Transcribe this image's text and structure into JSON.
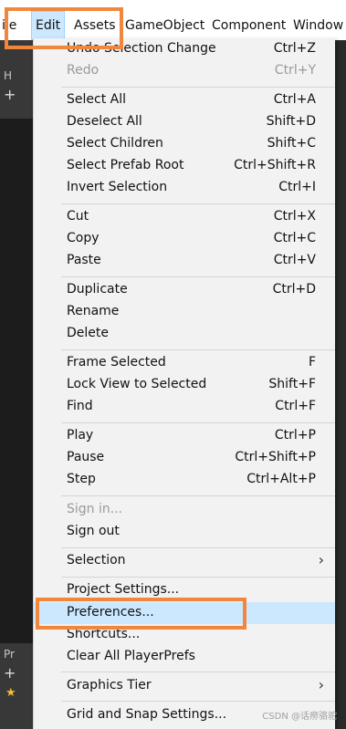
{
  "menubar": {
    "items": [
      {
        "label": "ile"
      },
      {
        "label": "Edit"
      },
      {
        "label": "Assets"
      },
      {
        "label": "GameObject"
      },
      {
        "label": "Component"
      },
      {
        "label": "Window"
      }
    ]
  },
  "background": {
    "hierarchy_label": "H",
    "plus": "+",
    "project_label": "Pr",
    "plus2": "+"
  },
  "menu": {
    "items": [
      {
        "label": "Undo Selection Change",
        "shortcut": "Ctrl+Z"
      },
      {
        "label": "Redo",
        "shortcut": "Ctrl+Y"
      },
      {
        "label": "Select All",
        "shortcut": "Ctrl+A"
      },
      {
        "label": "Deselect All",
        "shortcut": "Shift+D"
      },
      {
        "label": "Select Children",
        "shortcut": "Shift+C"
      },
      {
        "label": "Select Prefab Root",
        "shortcut": "Ctrl+Shift+R"
      },
      {
        "label": "Invert Selection",
        "shortcut": "Ctrl+I"
      },
      {
        "label": "Cut",
        "shortcut": "Ctrl+X"
      },
      {
        "label": "Copy",
        "shortcut": "Ctrl+C"
      },
      {
        "label": "Paste",
        "shortcut": "Ctrl+V"
      },
      {
        "label": "Duplicate",
        "shortcut": "Ctrl+D"
      },
      {
        "label": "Rename",
        "shortcut": ""
      },
      {
        "label": "Delete",
        "shortcut": ""
      },
      {
        "label": "Frame Selected",
        "shortcut": "F"
      },
      {
        "label": "Lock View to Selected",
        "shortcut": "Shift+F"
      },
      {
        "label": "Find",
        "shortcut": "Ctrl+F"
      },
      {
        "label": "Play",
        "shortcut": "Ctrl+P"
      },
      {
        "label": "Pause",
        "shortcut": "Ctrl+Shift+P"
      },
      {
        "label": "Step",
        "shortcut": "Ctrl+Alt+P"
      },
      {
        "label": "Sign in...",
        "shortcut": ""
      },
      {
        "label": "Sign out",
        "shortcut": ""
      },
      {
        "label": "Selection",
        "shortcut": ""
      },
      {
        "label": "Project Settings...",
        "shortcut": ""
      },
      {
        "label": "Preferences...",
        "shortcut": ""
      },
      {
        "label": "Shortcuts...",
        "shortcut": ""
      },
      {
        "label": "Clear All PlayerPrefs",
        "shortcut": ""
      },
      {
        "label": "Graphics Tier",
        "shortcut": ""
      },
      {
        "label": "Grid and Snap Settings...",
        "shortcut": ""
      }
    ],
    "submenu_arrow": "›"
  },
  "watermark": "CSDN @话痨骆驼",
  "colors": {
    "highlight_box": "#f0873c",
    "selected_item": "#cce8ff",
    "menu_bg": "#f2f2f2"
  }
}
